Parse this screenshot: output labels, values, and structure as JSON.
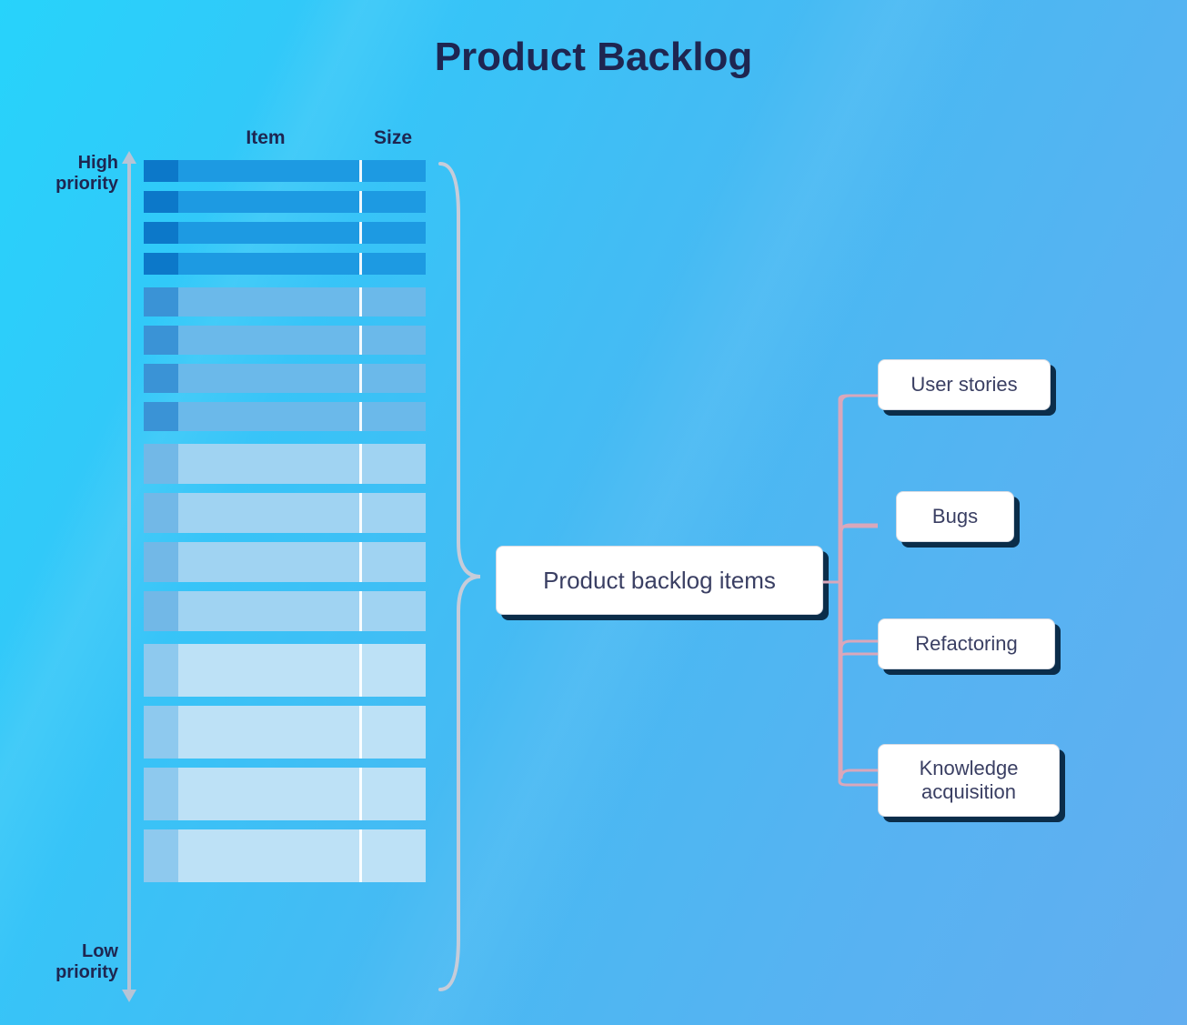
{
  "title": "Product Backlog",
  "columns": {
    "item": "Item",
    "size": "Size"
  },
  "priority": {
    "high": "High priority",
    "low": "Low priority"
  },
  "pbi_label": "Product backlog items",
  "types": [
    "User stories",
    "Bugs",
    "Refactoring",
    "Knowledge acquisition"
  ],
  "groups": [
    {
      "rows": 4,
      "class": "g1"
    },
    {
      "rows": 4,
      "class": "g2"
    },
    {
      "rows": 4,
      "class": "g3"
    },
    {
      "rows": 4,
      "class": "g4"
    }
  ]
}
